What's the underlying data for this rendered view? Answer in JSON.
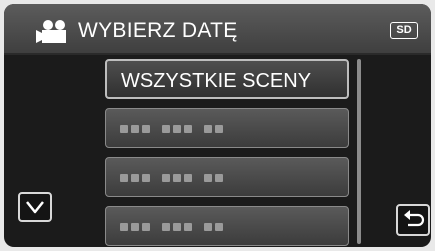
{
  "header": {
    "title": "WYBIERZ DATĘ",
    "mode_icon": "video-camera-icon",
    "media_badge": "SD"
  },
  "list": {
    "items": [
      {
        "label": "WSZYSTKIE SCENY",
        "selected": true
      },
      {
        "label": "",
        "placeholder": true
      },
      {
        "label": "",
        "placeholder": true
      },
      {
        "label": "",
        "placeholder": true
      }
    ]
  },
  "controls": {
    "scroll_down_icon": "chevron-down-icon",
    "back_icon": "return-arrow-icon"
  },
  "colors": {
    "background": "#1b1b1b",
    "header": "#4a4a4a",
    "item": "#4a4a4a",
    "text": "#ffffff"
  }
}
